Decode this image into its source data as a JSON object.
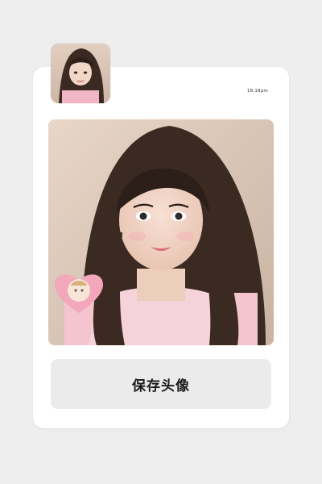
{
  "header": {
    "timestamp": "18:18pm"
  },
  "avatar": {
    "icon": "avatar-thumbnail"
  },
  "preview": {
    "icon": "portrait-photo"
  },
  "actions": {
    "save_label": "保存头像"
  },
  "colors": {
    "background": "#eeeeee",
    "card": "#ffffff",
    "button": "#ebebeb",
    "button_text": "#1a1a1a"
  }
}
